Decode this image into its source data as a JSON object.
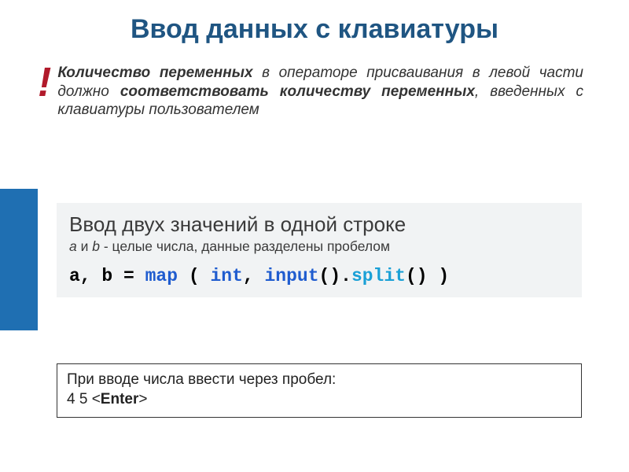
{
  "title": "Ввод данных с клавиатуры",
  "note": {
    "exclamation": "!",
    "seg1": "Количество переменных",
    "seg2": " в операторе присваивания в левой части должно ",
    "seg3": "соответствовать количеству переменных",
    "seg4": ", введенных с клавиатуры пользователем"
  },
  "box": {
    "title": "Ввод двух значений в одной строке",
    "sub_ab": "a",
    "sub_and": " и ",
    "sub_b": "b",
    "sub_rest": " - целые числа, данные разделены пробелом",
    "code": {
      "c1": "a, b = ",
      "c2": "map",
      "c3": " ( ",
      "c4": "int",
      "c5": ", ",
      "c6": "input",
      "c7": "().",
      "c8": "split",
      "c9": "()",
      "c10": " )"
    }
  },
  "bottom": {
    "line1": "При вводе числа ввести через пробел:",
    "line2_prefix": "4 5 <",
    "line2_enter": "Enter",
    "line2_suffix": ">"
  }
}
